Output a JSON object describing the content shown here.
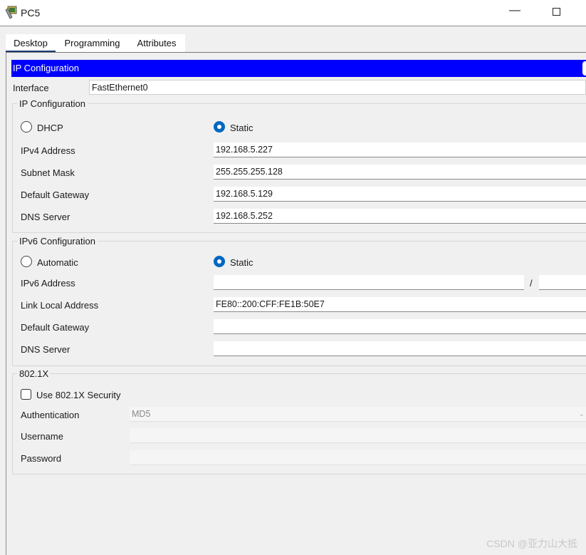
{
  "window": {
    "title": "PC5",
    "minimize_glyph": "—"
  },
  "tabs": [
    {
      "label": "Desktop",
      "active": true
    },
    {
      "label": "Programming"
    },
    {
      "label": "Attributes"
    }
  ],
  "header": {
    "title": "IP Configuration"
  },
  "interface": {
    "label": "Interface",
    "value": "FastEthernet0"
  },
  "ipv4": {
    "group_title": "IP Configuration",
    "dhcp_label": "DHCP",
    "static_label": "Static",
    "mode": "static",
    "fields": [
      {
        "label": "IPv4 Address",
        "value": "192.168.5.227"
      },
      {
        "label": "Subnet Mask",
        "value": "255.255.255.128"
      },
      {
        "label": "Default Gateway",
        "value": "192.168.5.129"
      },
      {
        "label": "DNS Server",
        "value": "192.168.5.252"
      }
    ]
  },
  "ipv6": {
    "group_title": "IPv6 Configuration",
    "automatic_label": "Automatic",
    "static_label": "Static",
    "mode": "static",
    "address_label": "IPv6 Address",
    "address_value": "",
    "prefix_separator": "/",
    "prefix_value": "",
    "link_local_label": "Link Local Address",
    "link_local_value": "FE80::200:CFF:FE1B:50E7",
    "gateway_label": "Default Gateway",
    "gateway_value": "",
    "dns_label": "DNS Server",
    "dns_value": ""
  },
  "dot1x": {
    "group_title": "802.1X",
    "use_security_label": "Use 802.1X Security",
    "use_security_checked": false,
    "auth_label": "Authentication",
    "auth_value": "MD5",
    "username_label": "Username",
    "username_value": "",
    "password_label": "Password",
    "password_value": ""
  },
  "watermark": "CSDN @亚力山大抵"
}
